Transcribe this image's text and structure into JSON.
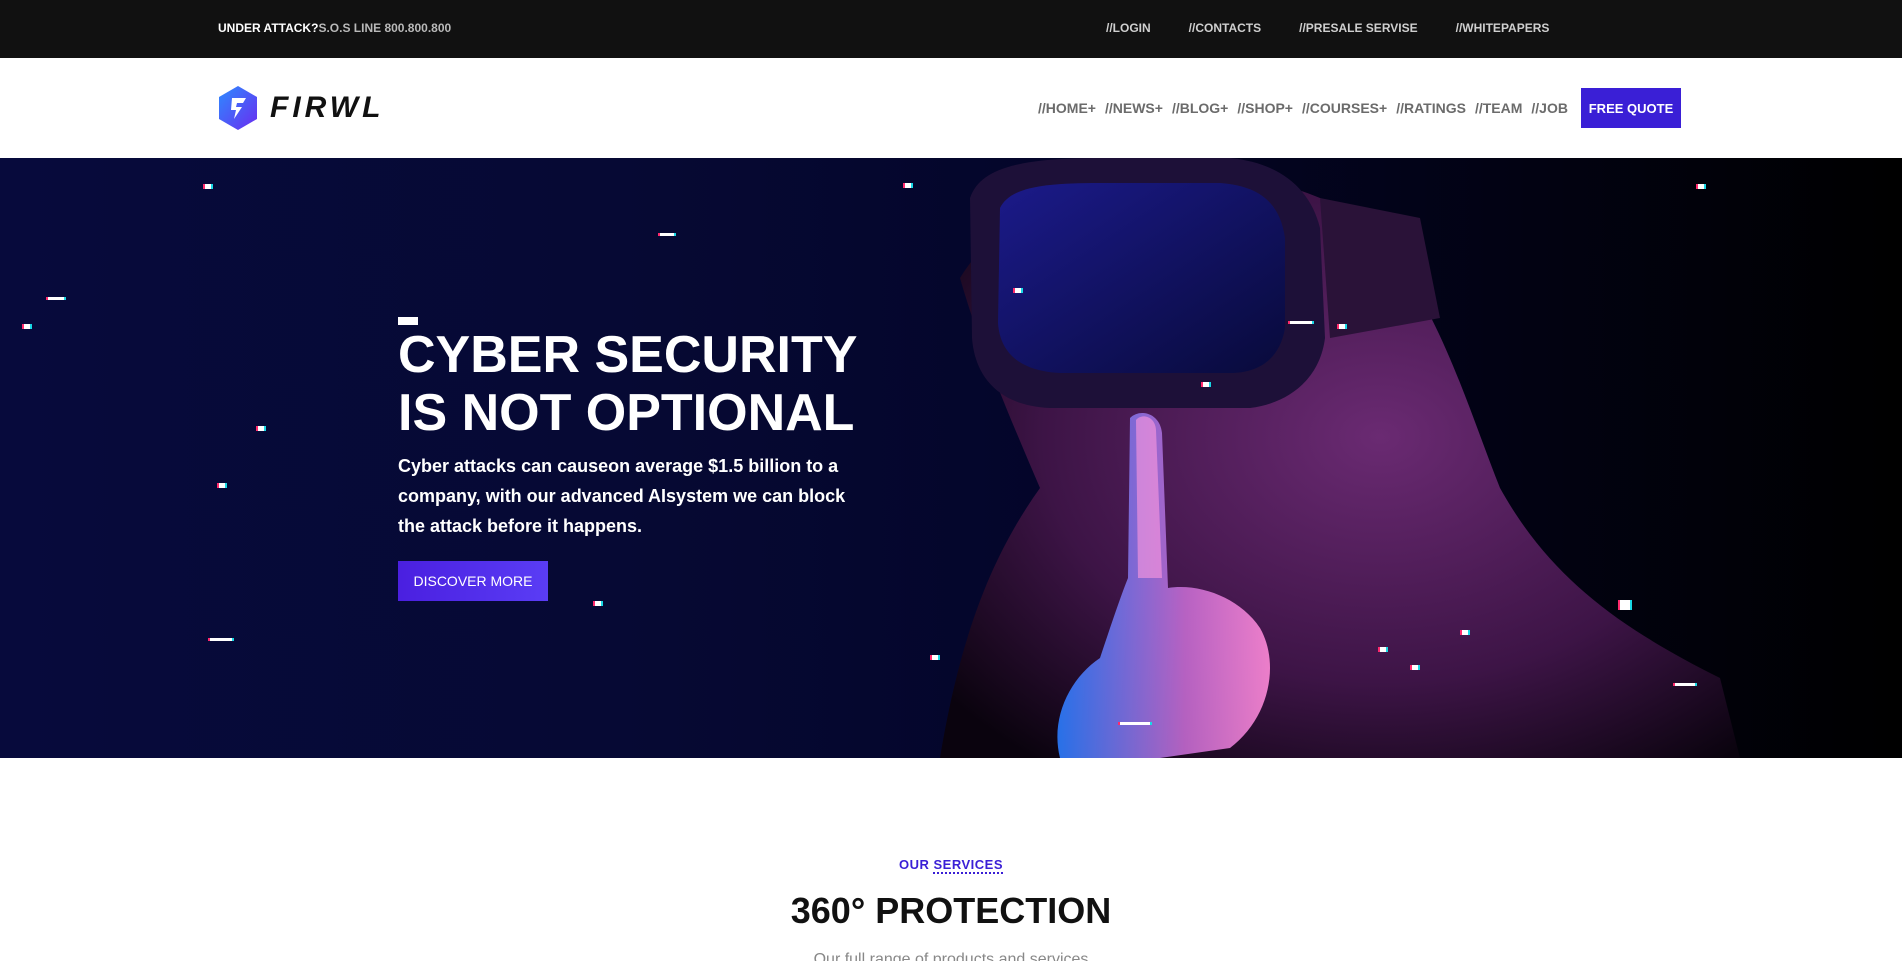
{
  "topbar": {
    "alert_label": "UNDER ATTACK?",
    "sos_text": "S.O.S LINE 800.800.800",
    "links": [
      "//LOGIN",
      "//CONTACTS",
      "//PRESALE SERVISE",
      "//WHITEPAPERS"
    ]
  },
  "header": {
    "logo_text": "FIRWL",
    "logo_icon": "lightning-hex-icon",
    "nav": [
      "//HOME+",
      "//NEWS+",
      "//BLOG+",
      "//SHOP+",
      "//COURSES+",
      "//RATINGS",
      "//TEAM",
      "//JOB"
    ],
    "cta_label": "FREE QUOTE"
  },
  "hero": {
    "title_line1": "CYBER SECURITY",
    "title_line2": "IS NOT OPTIONAL",
    "description": "Cyber attacks can causeon average $1.5 billion to a company, with our advanced AIsystem we can block the attack before it happens.",
    "button_label": "DISCOVER MORE",
    "image": "person-vr-headset-silence-gesture"
  },
  "services": {
    "tag_prefix": "OUR ",
    "tag_underlined": "SERVICES",
    "title": "360° PROTECTION",
    "subtitle": "Our full range of products and services"
  },
  "colors": {
    "accent": "#3a1fd6",
    "topbar_bg": "#111111",
    "hero_bg": "#070a3c"
  }
}
